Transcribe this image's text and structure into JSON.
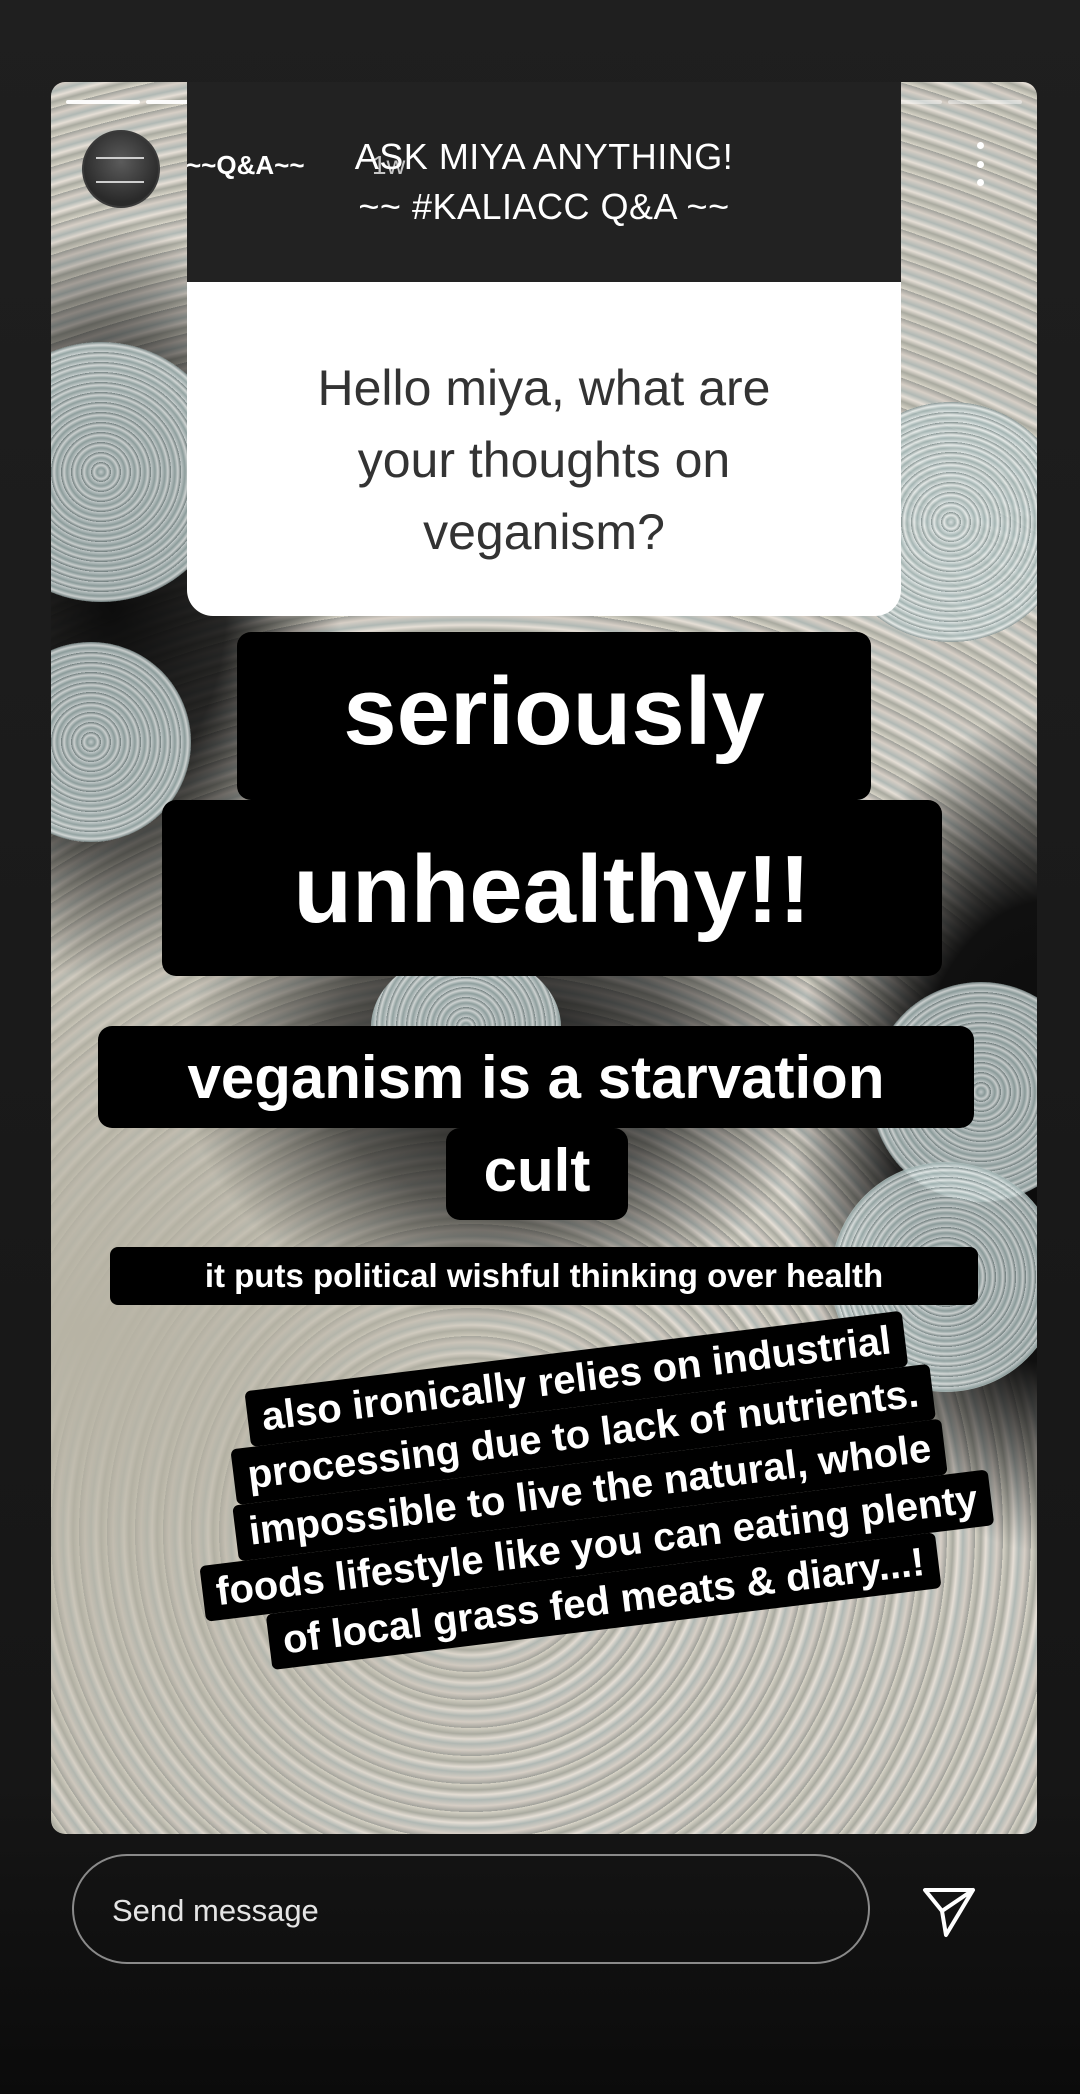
{
  "story": {
    "username": "~~Q&A~~",
    "time": "1w",
    "progress_segments": 12,
    "progress_done": 10
  },
  "question": {
    "header_line1": "ASK MIYA ANYTHING!",
    "header_line2": "~~ #KALIACC Q&A ~~",
    "body_lines": [
      "Hello miya, what are",
      "your thoughts on",
      "veganism?"
    ]
  },
  "answers": {
    "line1": "seriously",
    "line2": "unhealthy!!",
    "line3": "veganism is a starvation",
    "line4": "cult",
    "line5": "it puts political wishful thinking over health",
    "rotated": [
      "also ironically relies on industrial",
      "processing due to lack of nutrients.",
      "impossible to live the natural, whole",
      "foods lifestyle like you can eating plenty",
      "of local grass fed meats & diary...!"
    ]
  },
  "reply": {
    "placeholder": "Send message"
  },
  "icons": {
    "more": "more-vertical-icon",
    "send": "send-icon"
  },
  "colors": {
    "background": "#1c1c1c",
    "tag_bg": "#000000",
    "tag_text": "#ffffff",
    "question_header_bg": "#222222",
    "question_body_bg": "#ffffff"
  }
}
